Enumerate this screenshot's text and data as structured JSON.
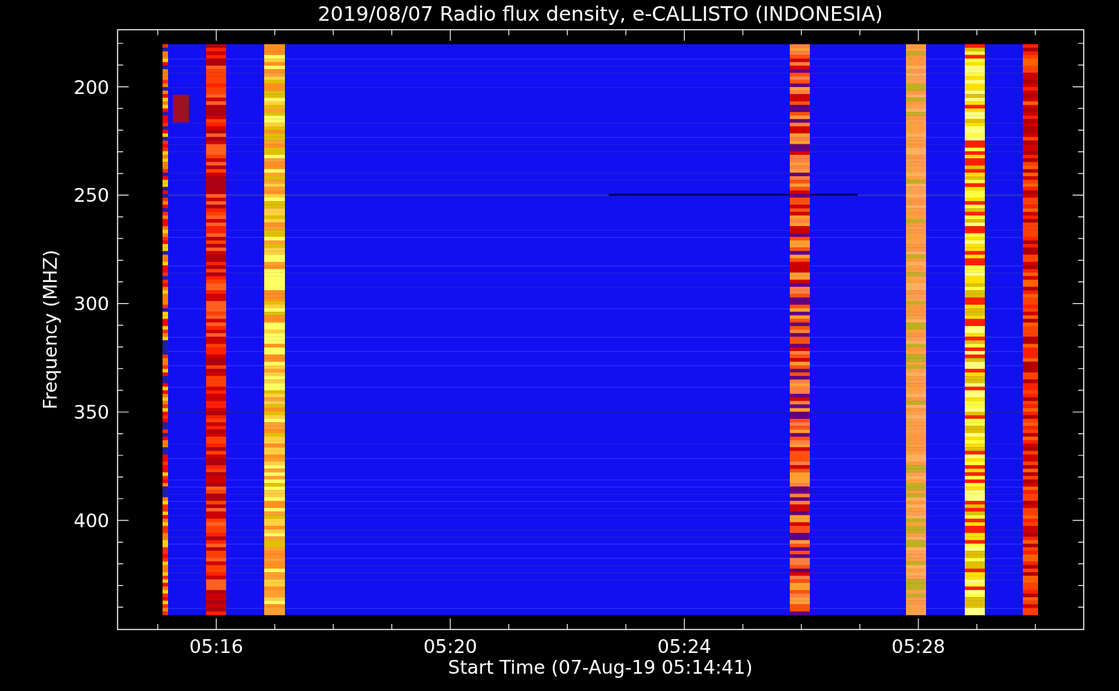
{
  "plot": {
    "title": "2019/08/07  Radio flux density, e-CALLISTO (INDONESIA)",
    "ylabel": "Frequency (MHZ)",
    "xlabel": "Start Time (07-Aug-19 05:14:41)",
    "yticks": [
      "200",
      "250",
      "300",
      "350",
      "400"
    ],
    "xticks": [
      "05:16",
      "05:20",
      "05:24",
      "05:28"
    ]
  }
}
